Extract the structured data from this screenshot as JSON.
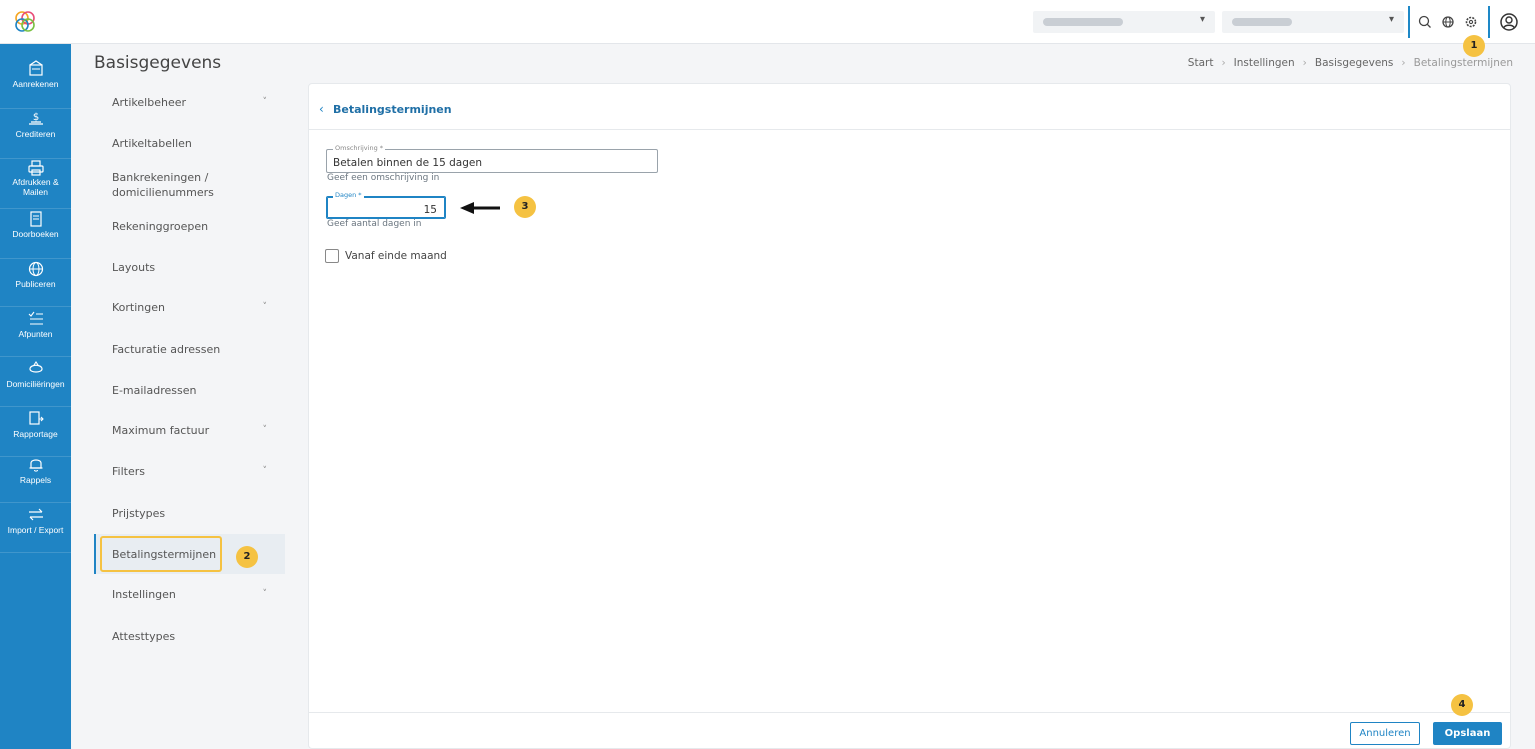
{
  "page": {
    "title": "Basisgegevens"
  },
  "breadcrumb": [
    "Start",
    "Instellingen",
    "Basisgegevens",
    "Betalingstermijnen"
  ],
  "leftnav": [
    {
      "label": "Aanrekenen",
      "icon": "invoice-icon"
    },
    {
      "label": "Crediteren",
      "icon": "credit-icon"
    },
    {
      "label": "Afdrukken & Mailen",
      "icon": "printer-icon"
    },
    {
      "label": "Doorboeken",
      "icon": "book-icon"
    },
    {
      "label": "Publiceren",
      "icon": "globe-icon"
    },
    {
      "label": "Afpunten",
      "icon": "checklist-icon"
    },
    {
      "label": "Domiciliëringen",
      "icon": "piggy-bank-icon"
    },
    {
      "label": "Rapportage",
      "icon": "report-icon"
    },
    {
      "label": "Rappels",
      "icon": "bell-icon"
    },
    {
      "label": "Import / Export",
      "icon": "transfer-icon"
    }
  ],
  "submenu": [
    {
      "label": "Artikelbeheer",
      "chevron": true
    },
    {
      "label": "Artikeltabellen",
      "chevron": false
    },
    {
      "label": "Bankrekeningen / domicilienummers",
      "chevron": false
    },
    {
      "label": "Rekeninggroepen",
      "chevron": false
    },
    {
      "label": "Layouts",
      "chevron": false
    },
    {
      "label": "Kortingen",
      "chevron": true
    },
    {
      "label": "Facturatie adressen",
      "chevron": false
    },
    {
      "label": "E-mailadressen",
      "chevron": false
    },
    {
      "label": "Maximum factuur",
      "chevron": true
    },
    {
      "label": "Filters",
      "chevron": true
    },
    {
      "label": "Prijstypes",
      "chevron": false
    },
    {
      "label": "Betalingstermijnen",
      "chevron": false,
      "active": true
    },
    {
      "label": "Instellingen",
      "chevron": true
    },
    {
      "label": "Attesttypes",
      "chevron": false
    }
  ],
  "card": {
    "title": "Betalingstermijnen",
    "omschrijving": {
      "legend": "Omschrijving *",
      "value": "Betalen binnen de 15 dagen",
      "hint": "Geef een omschrijving in"
    },
    "dagen": {
      "legend": "Dagen *",
      "value": "15",
      "hint": "Geef aantal dagen in"
    },
    "checkbox_label": "Vanaf einde maand",
    "cancel_label": "Annuleren",
    "save_label": "Opslaan"
  },
  "badges": [
    "1",
    "2",
    "3",
    "4"
  ],
  "colors": {
    "primary": "#1f84c4",
    "highlight": "#f5c242"
  }
}
